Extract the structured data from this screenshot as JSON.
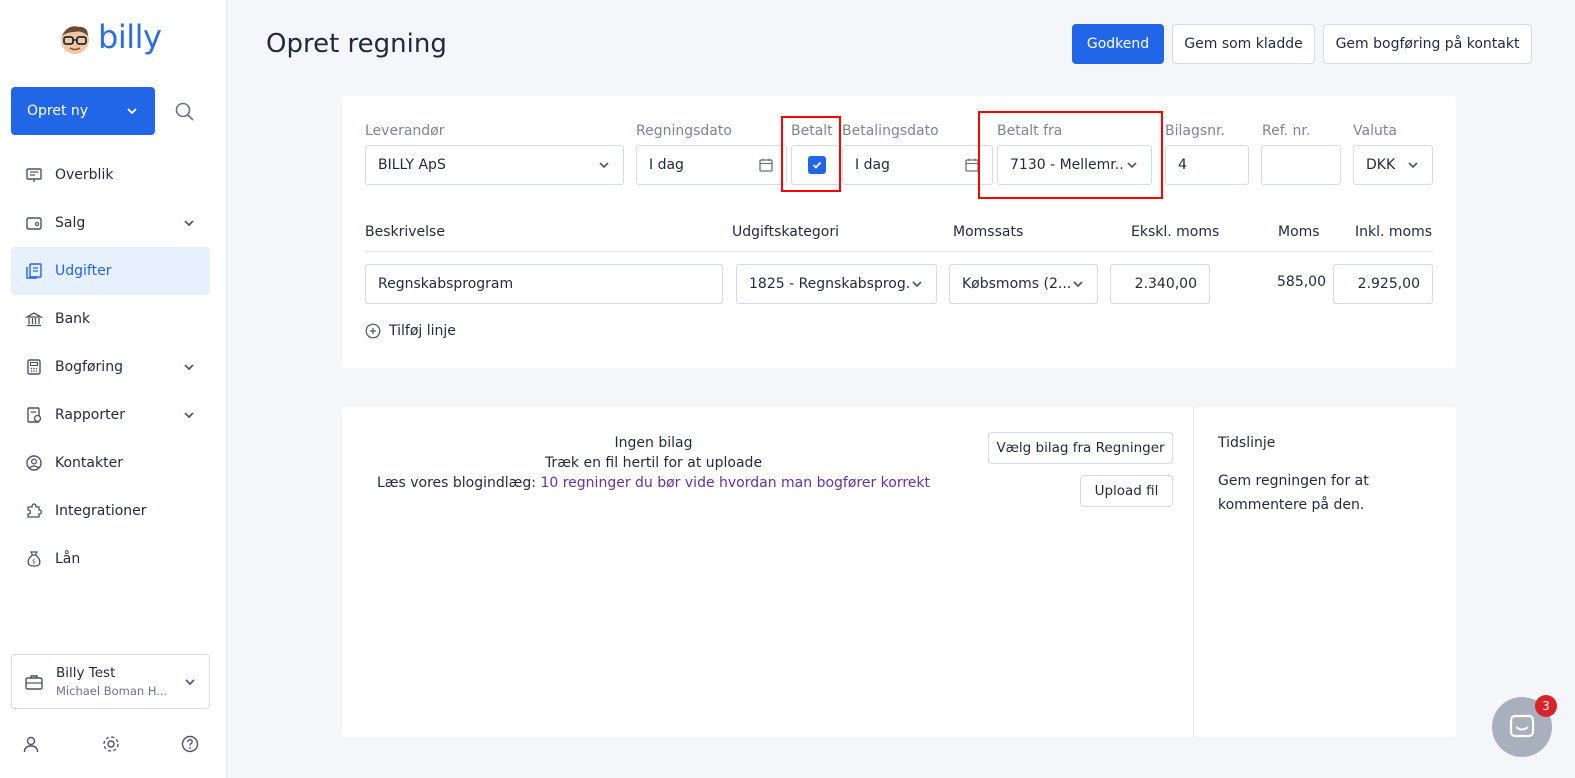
{
  "app": {
    "logo_text": "billy"
  },
  "sidebar": {
    "create_label": "Opret ny",
    "items": [
      {
        "label": "Overblik"
      },
      {
        "label": "Salg"
      },
      {
        "label": "Udgifter"
      },
      {
        "label": "Bank"
      },
      {
        "label": "Bogføring"
      },
      {
        "label": "Rapporter"
      },
      {
        "label": "Kontakter"
      },
      {
        "label": "Integrationer"
      },
      {
        "label": "Lån"
      }
    ],
    "org": {
      "name": "Billy Test",
      "user": "Michael Boman H..."
    }
  },
  "header": {
    "title": "Opret regning",
    "approve_label": "Godkend",
    "draft_label": "Gem som kladde",
    "save_contact_label": "Gem bogføring på kontakt"
  },
  "form": {
    "vendor": {
      "label": "Leverandør",
      "value": "BILLY ApS"
    },
    "bill_date": {
      "label": "Regningsdato",
      "value": "I dag"
    },
    "paid": {
      "label": "Betalt",
      "checked": true
    },
    "payment_date": {
      "label": "Betalingsdato",
      "value": "I dag"
    },
    "paid_from": {
      "label": "Betalt fra",
      "value": "7130 - Mellemr..."
    },
    "voucher_no": {
      "label": "Bilagsnr.",
      "value": "4"
    },
    "ref_no": {
      "label": "Ref. nr.",
      "value": ""
    },
    "currency": {
      "label": "Valuta",
      "value": "DKK"
    }
  },
  "lines": {
    "headers": {
      "description": "Beskrivelse",
      "category": "Udgiftskategori",
      "vat_rate": "Momssats",
      "excl": "Ekskl. moms",
      "vat": "Moms",
      "incl": "Inkl. moms"
    },
    "rows": [
      {
        "description": "Regnskabsprogram",
        "category": "1825 - Regnskabsprog...",
        "vat_rate": "Købsmoms (2...",
        "excl": "2.340,00",
        "vat": "585,00",
        "incl": "2.925,00"
      }
    ],
    "add_line_label": "Tilføj linje"
  },
  "attachments": {
    "none_text": "Ingen bilag",
    "drag_text": "Træk en fil hertil for at uploade",
    "blog_prefix": "Læs vores blogindlæg: ",
    "blog_link": "10 regninger du bør vide hvordan man bogfører korrekt",
    "choose_label": "Vælg bilag fra Regninger",
    "upload_label": "Upload fil"
  },
  "timeline": {
    "title": "Tidslinje",
    "text": "Gem regningen for at kommentere på den."
  },
  "chat": {
    "badge": "3"
  },
  "colors": {
    "primary": "#2266e8",
    "highlight": "#ff0000",
    "link": "#6b2f9e"
  }
}
